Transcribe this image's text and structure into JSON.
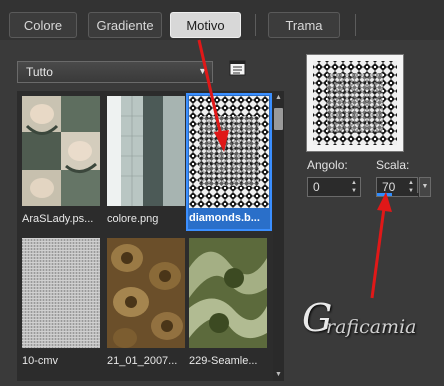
{
  "tabs": [
    {
      "label": "Colore",
      "active": false
    },
    {
      "label": "Gradiente",
      "active": false
    },
    {
      "label": "Motivo",
      "active": true
    },
    {
      "label": "Trama",
      "active": false
    }
  ],
  "category_dropdown": {
    "value": "Tutto"
  },
  "patterns": [
    {
      "name": "AraSLady.ps...",
      "selected": false
    },
    {
      "name": "colore.png",
      "selected": false
    },
    {
      "name": "diamonds.b...",
      "selected": true
    },
    {
      "name": "10-cmv",
      "selected": false
    },
    {
      "name": "21_01_2007...",
      "selected": false
    },
    {
      "name": "229-Seamle...",
      "selected": false
    }
  ],
  "angle": {
    "label": "Angolo:",
    "value": "0"
  },
  "scale": {
    "label": "Scala:",
    "value": "70",
    "slider_fraction": 0.35
  },
  "watermark": {
    "initial": "G",
    "text": "raficamia"
  },
  "colors": {
    "accent": "#2f8cff",
    "selection": "#2a6fc9",
    "annotation": "#e01818"
  }
}
